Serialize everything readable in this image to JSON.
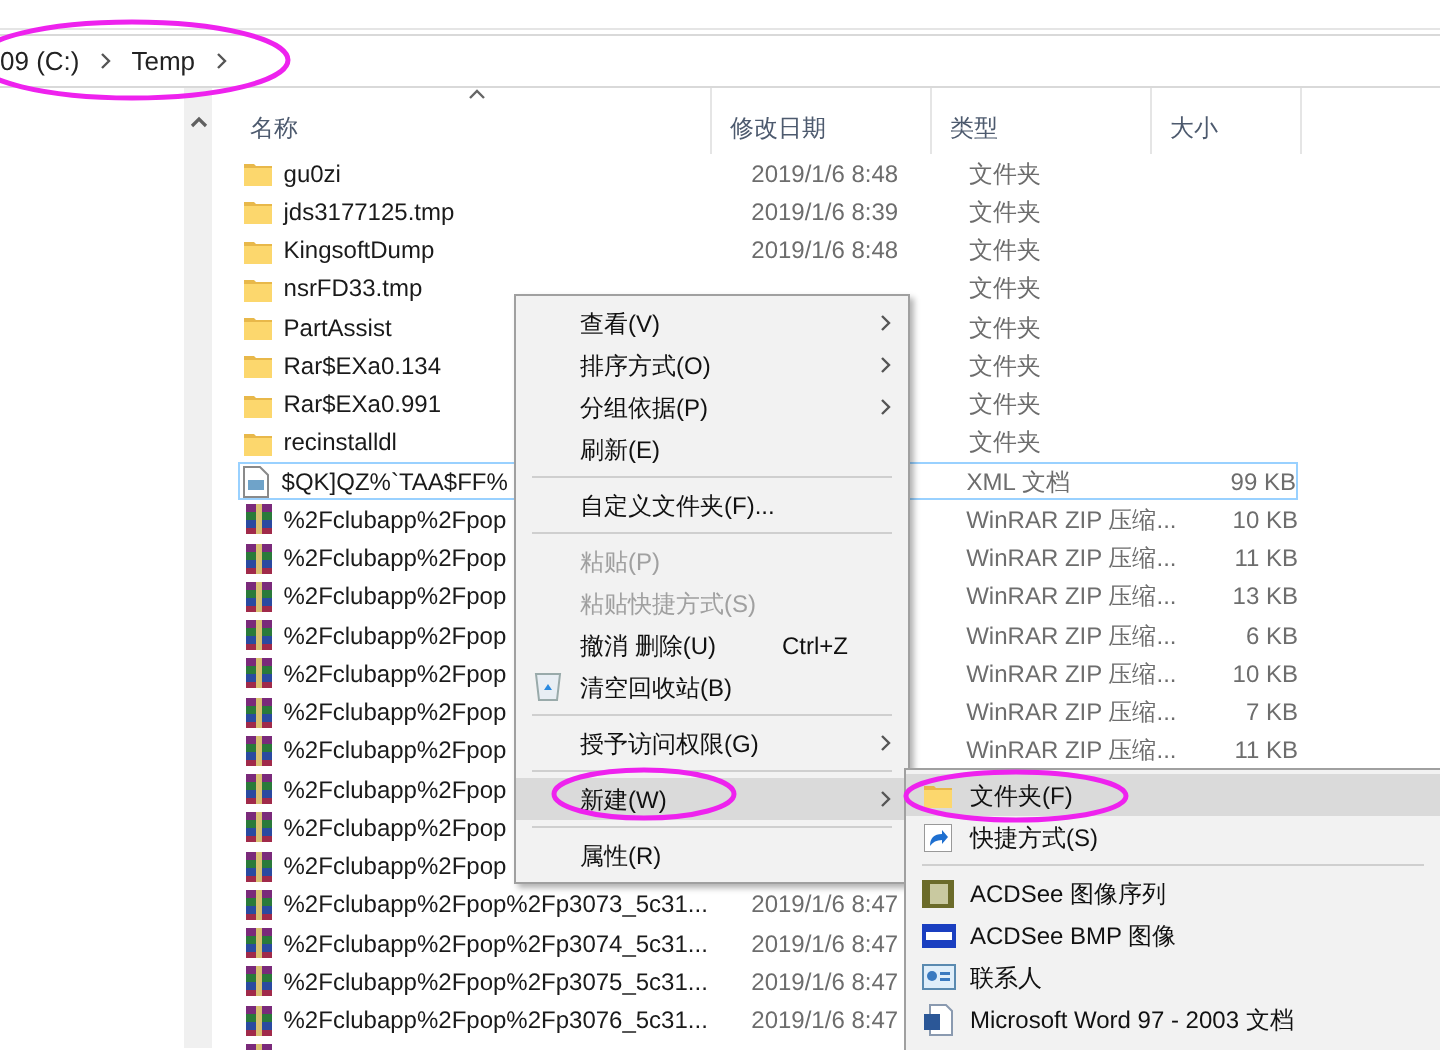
{
  "address_bar": {
    "crumbs": [
      "09 (C:)",
      "Temp"
    ]
  },
  "columns": [
    "名称",
    "修改日期",
    "类型",
    "大小"
  ],
  "rows": [
    {
      "kind": "folder",
      "name": "gu0zi",
      "date": "2019/1/6 8:48",
      "type": "文件夹",
      "selected": false
    },
    {
      "kind": "folder",
      "name": "jds3177125.tmp",
      "date": "2019/1/6 8:39",
      "type": "文件夹",
      "selected": false
    },
    {
      "kind": "folder",
      "name": "KingsoftDump",
      "date": "2019/1/6 8:48",
      "type": "文件夹",
      "selected": false
    },
    {
      "kind": "folder",
      "name": "nsrFD33.tmp",
      "type": "文件夹",
      "selected": false
    },
    {
      "kind": "folder",
      "name": "PartAssist",
      "type": "文件夹",
      "selected": false
    },
    {
      "kind": "folder",
      "name": "Rar$EXa0.134",
      "type": "文件夹",
      "selected": false
    },
    {
      "kind": "folder",
      "name": "Rar$EXa0.991",
      "type": "文件夹",
      "selected": false
    },
    {
      "kind": "folder",
      "name": "recinstalldl",
      "type": "文件夹",
      "selected": false
    },
    {
      "kind": "xml",
      "name": "$QK]QZ%`TAA$FF%",
      "type": "XML 文档",
      "size": "99 KB",
      "selected": true
    },
    {
      "kind": "archive",
      "name": "%2Fclubapp%2Fpop",
      "type": "WinRAR ZIP 压缩...",
      "size": "10 KB",
      "selected": false
    },
    {
      "kind": "archive",
      "name": "%2Fclubapp%2Fpop",
      "type": "WinRAR ZIP 压缩...",
      "size": "11 KB",
      "selected": false
    },
    {
      "kind": "archive",
      "name": "%2Fclubapp%2Fpop",
      "type": "WinRAR ZIP 压缩...",
      "size": "13 KB",
      "selected": false
    },
    {
      "kind": "archive",
      "name": "%2Fclubapp%2Fpop",
      "type": "WinRAR ZIP 压缩...",
      "size": "6 KB",
      "selected": false
    },
    {
      "kind": "archive",
      "name": "%2Fclubapp%2Fpop",
      "type": "WinRAR ZIP 压缩...",
      "size": "10 KB",
      "selected": false
    },
    {
      "kind": "archive",
      "name": "%2Fclubapp%2Fpop",
      "type": "WinRAR ZIP 压缩...",
      "size": "7 KB",
      "selected": false
    },
    {
      "kind": "archive",
      "name": "%2Fclubapp%2Fpop",
      "type": "WinRAR ZIP 压缩...",
      "size": "11 KB",
      "selected": false
    },
    {
      "kind": "archive",
      "name": "%2Fclubapp%2Fpop",
      "selected": false
    },
    {
      "kind": "archive",
      "name": "%2Fclubapp%2Fpop",
      "selected": false
    },
    {
      "kind": "archive",
      "name": "%2Fclubapp%2Fpop",
      "selected": false
    },
    {
      "kind": "archive",
      "name": "%2Fclubapp%2Fpop%2Fp3073_5c31...",
      "date": "2019/1/6 8:47",
      "selected": false
    },
    {
      "kind": "archive",
      "name": "%2Fclubapp%2Fpop%2Fp3074_5c31...",
      "date": "2019/1/6 8:47",
      "selected": false
    },
    {
      "kind": "archive",
      "name": "%2Fclubapp%2Fpop%2Fp3075_5c31...",
      "date": "2019/1/6 8:47",
      "selected": false
    },
    {
      "kind": "archive",
      "name": "%2Fclubapp%2Fpop%2Fp3076_5c31...",
      "date": "2019/1/6 8:47",
      "selected": false
    },
    {
      "kind": "archive",
      "selected": false
    }
  ],
  "context_menu": [
    {
      "kind": "item",
      "label": "查看(V)",
      "submenu": true,
      "disabled": false,
      "selected": false
    },
    {
      "kind": "item",
      "label": "排序方式(O)",
      "submenu": true,
      "disabled": false,
      "selected": false
    },
    {
      "kind": "item",
      "label": "分组依据(P)",
      "submenu": true,
      "disabled": false,
      "selected": false
    },
    {
      "kind": "item",
      "label": "刷新(E)",
      "submenu": false,
      "disabled": false,
      "selected": false
    },
    {
      "kind": "separator"
    },
    {
      "kind": "item",
      "label": "自定义文件夹(F)...",
      "submenu": false,
      "disabled": false,
      "selected": false
    },
    {
      "kind": "separator"
    },
    {
      "kind": "item",
      "label": "粘贴(P)",
      "submenu": false,
      "disabled": true,
      "selected": false
    },
    {
      "kind": "item",
      "label": "粘贴快捷方式(S)",
      "submenu": false,
      "disabled": true,
      "selected": false
    },
    {
      "kind": "item",
      "label": "撤消 删除(U)",
      "shortcut": "Ctrl+Z",
      "submenu": false,
      "disabled": false,
      "selected": false
    },
    {
      "kind": "item",
      "label": "清空回收站(B)",
      "submenu": false,
      "disabled": false,
      "selected": false
    },
    {
      "kind": "separator"
    },
    {
      "kind": "item",
      "label": "授予访问权限(G)",
      "submenu": true,
      "disabled": false,
      "selected": false
    },
    {
      "kind": "separator"
    },
    {
      "kind": "item",
      "label": "新建(W)",
      "submenu": true,
      "disabled": false,
      "selected": true
    },
    {
      "kind": "separator"
    },
    {
      "kind": "item",
      "label": "属性(R)",
      "submenu": false,
      "disabled": false,
      "selected": false
    }
  ],
  "new_submenu": [
    {
      "kind": "item",
      "label": "文件夹(F)",
      "selected": true
    },
    {
      "kind": "item",
      "label": "快捷方式(S)",
      "selected": false
    },
    {
      "kind": "separator"
    },
    {
      "kind": "item",
      "label": "ACDSee 图像序列",
      "selected": false
    },
    {
      "kind": "item",
      "label": "ACDSee BMP 图像",
      "selected": false
    },
    {
      "kind": "item",
      "label": "联系人",
      "selected": false
    },
    {
      "kind": "item",
      "label": "Microsoft Word 97 - 2003 文档",
      "selected": false
    }
  ]
}
